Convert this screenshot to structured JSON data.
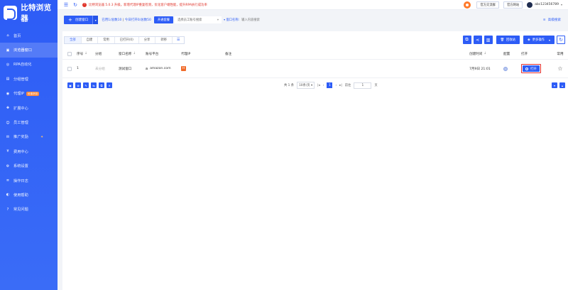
{
  "app": {
    "name": "比特浏览器"
  },
  "sidebar": {
    "items": [
      {
        "label": "首页",
        "icon": "home-icon"
      },
      {
        "label": "浏览器窗口",
        "icon": "window-icon",
        "active": true
      },
      {
        "label": "RPA自动化",
        "icon": "robot-icon"
      },
      {
        "label": "分组管理",
        "icon": "folder-icon"
      },
      {
        "label": "代理IP",
        "icon": "proxy-icon",
        "badge": "优惠折扣"
      },
      {
        "label": "扩展中心",
        "icon": "puzzle-icon"
      },
      {
        "label": "员工管理",
        "icon": "users-icon"
      },
      {
        "label": "推广奖励",
        "icon": "gift-icon"
      },
      {
        "label": "费用中心",
        "icon": "wallet-icon"
      },
      {
        "label": "系统设置",
        "icon": "gear-icon"
      },
      {
        "label": "操作日志",
        "icon": "log-icon"
      },
      {
        "label": "使用帮助",
        "icon": "help-icon"
      },
      {
        "label": "常见问题",
        "icon": "question-icon"
      }
    ]
  },
  "topbar": {
    "notice": "比特浏览器 5.0.3 升级。新增代理IP重复检测，优化客户端性能，提升RPA执行成功率",
    "official_group": "官方交流群",
    "official_site": "官方网站",
    "username": "abc123456789"
  },
  "filter": {
    "create_label": "创建窗口",
    "usage_used": "已用1/总数10",
    "usage_open": "今日打开0/总数50",
    "plan_label": "开通套餐",
    "employee_placeholder": "选择员工账号搜索",
    "window_search_label": "窗口名称:",
    "window_search_placeholder": "输入内容搜索",
    "advanced_label": "高级搜索"
  },
  "tabs": [
    "全部",
    "自建",
    "常用",
    "已打开(0)",
    "分享",
    "转移"
  ],
  "toolbar": {
    "recycle_label": "回收站",
    "more_label": "更多操作"
  },
  "table": {
    "headers": {
      "index": "序号",
      "group": "分组",
      "window_name": "窗口名称",
      "platform": "账号平台",
      "proxy": "代理IP",
      "remark": "备注",
      "created": "创建时间",
      "config": "配置",
      "open": "打开",
      "favorite": "常用"
    },
    "rows": [
      {
        "index": "1",
        "group": "未分组",
        "window_name": "测试窗口",
        "platform": "amazon.com",
        "proxy_icon": "H",
        "remark": "",
        "created": "7月9日 21:01",
        "open_label": "打开"
      }
    ]
  },
  "pager": {
    "total": "共 1 条",
    "page_size": "10条/页",
    "current_page": "1",
    "goto_label": "前往",
    "goto_value": "1",
    "page_unit": "页"
  },
  "colors": {
    "primary": "#2d5cf6",
    "highlight": "#e02e2e",
    "warning": "#e0352b"
  }
}
